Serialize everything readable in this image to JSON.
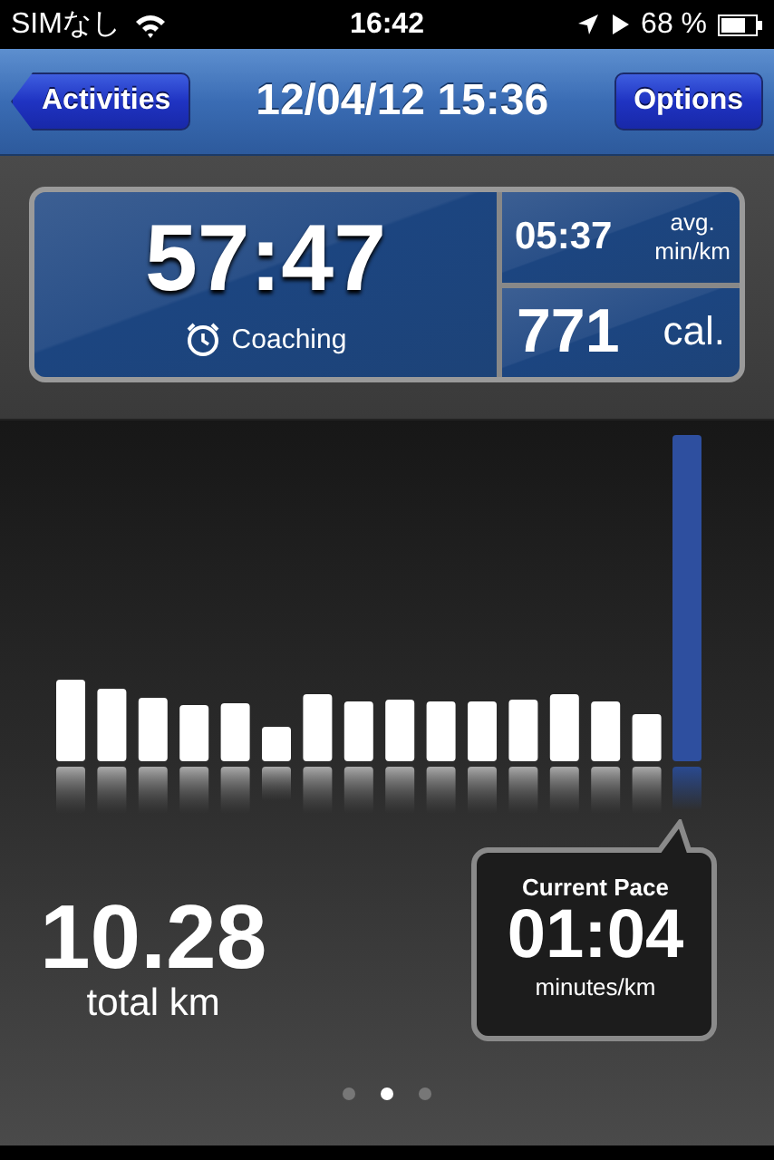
{
  "status_bar": {
    "carrier": "SIMなし",
    "time": "16:42",
    "battery": "68 %"
  },
  "nav_bar": {
    "back_button": "Activities",
    "title": "12/04/12 15:36",
    "right_button": "Options"
  },
  "stats": {
    "duration": "57:47",
    "coaching": "Coaching",
    "pace": "05:37",
    "pace_unit_1": "avg.",
    "pace_unit_2": "min/km",
    "calories": "771",
    "calories_unit": "cal."
  },
  "distance": {
    "value": "10.28",
    "unit": "total km"
  },
  "current_pace": {
    "title": "Current Pace",
    "value": "01:04",
    "unit": "minutes/km"
  },
  "page_dots": [
    {
      "selected": false
    },
    {
      "selected": true
    },
    {
      "selected": false
    }
  ]
}
